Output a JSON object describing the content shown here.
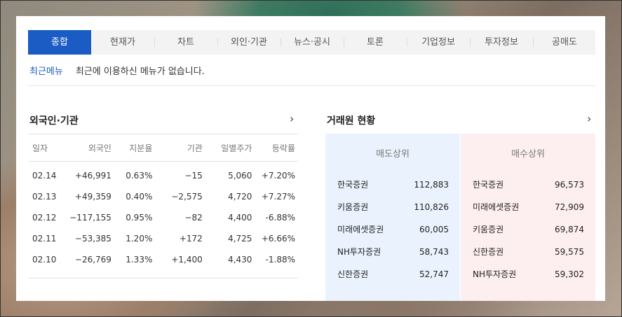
{
  "tabs": [
    "종합",
    "현재가",
    "차트",
    "외인·기관",
    "뉴스·공시",
    "토론",
    "기업정보",
    "투자정보",
    "공매도"
  ],
  "recent": {
    "label": "최근메뉴",
    "message": "최근에 이용하신 메뉴가 없습니다."
  },
  "foreign": {
    "title": "외국인·기관",
    "headers": [
      "일자",
      "외국인",
      "지분율",
      "기관",
      "일별주가",
      "등락률"
    ],
    "rows": [
      {
        "date": "02.14",
        "foreign": "+46,991",
        "ratio": "0.63%",
        "inst": "−15",
        "price": "5,060",
        "change": "+7.20%"
      },
      {
        "date": "02.13",
        "foreign": "+49,359",
        "ratio": "0.40%",
        "inst": "−2,575",
        "price": "4,720",
        "change": "+7.27%"
      },
      {
        "date": "02.12",
        "foreign": "−117,155",
        "ratio": "0.95%",
        "inst": "−82",
        "price": "4,400",
        "change": "-6.88%"
      },
      {
        "date": "02.11",
        "foreign": "−53,385",
        "ratio": "1.20%",
        "inst": "+172",
        "price": "4,725",
        "change": "+6.66%"
      },
      {
        "date": "02.10",
        "foreign": "−26,769",
        "ratio": "1.33%",
        "inst": "+1,400",
        "price": "4,430",
        "change": "-1.88%"
      }
    ]
  },
  "broker": {
    "title": "거래원 현황",
    "sell_title": "매도상위",
    "buy_title": "매수상위",
    "sell": [
      {
        "name": "한국증권",
        "value": "112,883"
      },
      {
        "name": "키움증권",
        "value": "110,826"
      },
      {
        "name": "미래에셋증권",
        "value": "60,005"
      },
      {
        "name": "NH투자증권",
        "value": "58,743"
      },
      {
        "name": "신한증권",
        "value": "52,747"
      }
    ],
    "buy": [
      {
        "name": "한국증권",
        "value": "96,573"
      },
      {
        "name": "미래에셋증권",
        "value": "72,909"
      },
      {
        "name": "키움증권",
        "value": "69,874"
      },
      {
        "name": "신한증권",
        "value": "59,575"
      },
      {
        "name": "NH투자증권",
        "value": "59,302"
      }
    ]
  },
  "colors": {
    "active_tab": "#1a5bc4",
    "up": "#e02222",
    "down": "#1a5bc4",
    "sell_bg": "#eaf3fd",
    "buy_bg": "#fdeff0"
  }
}
